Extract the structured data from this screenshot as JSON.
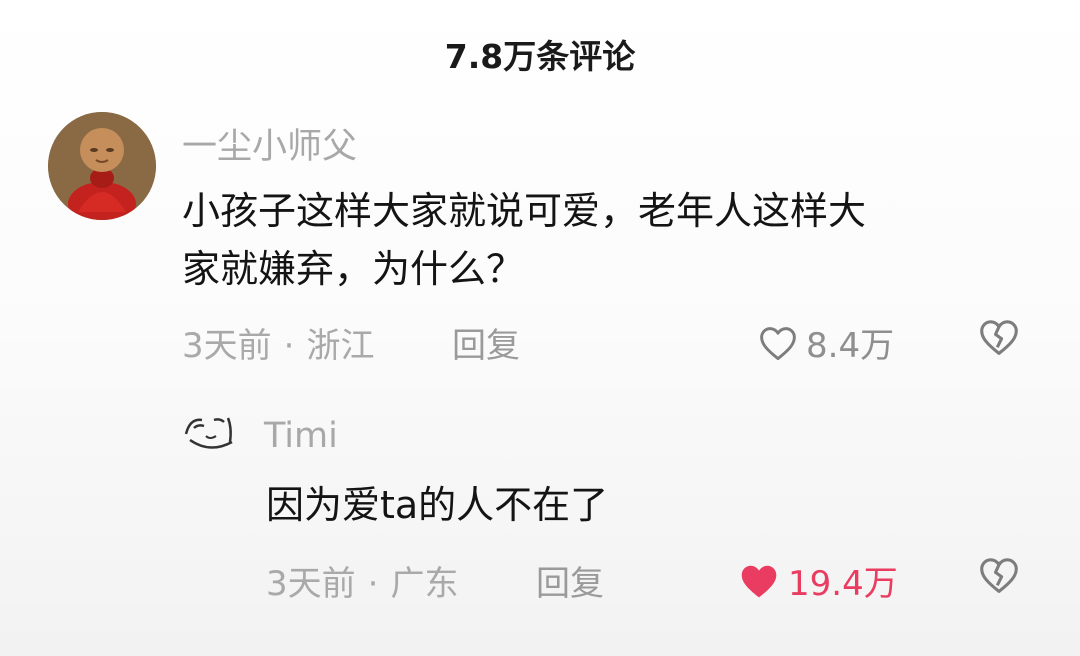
{
  "header": {
    "comment_count": "7.8万条评论"
  },
  "comment": {
    "username": "一尘小师父",
    "text_line1": "小孩子这样大家就说可爱，老年人这样大",
    "text_line2": "家就嫌弃，为什么？",
    "time": "3天前",
    "separator": "·",
    "location": "浙江",
    "reply_label": "回复",
    "likes": "8.4万"
  },
  "reply": {
    "username": "Timi",
    "text": "因为爱ta的人不在了",
    "time": "3天前",
    "separator": "·",
    "location": "广东",
    "reply_label": "回复",
    "likes": "19.4万",
    "liked": true
  },
  "colors": {
    "like_active": "#ea3c60",
    "muted": "#a9a9a9"
  },
  "icons": [
    "heart-outline-icon",
    "heart-filled-icon",
    "broken-heart-icon",
    "avatar-monk",
    "avatar-doodle"
  ]
}
